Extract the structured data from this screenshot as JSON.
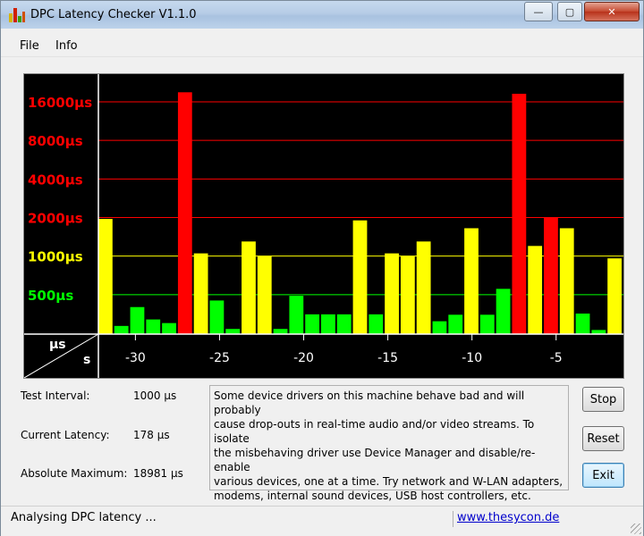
{
  "window": {
    "title": "DPC Latency Checker V1.1.0"
  },
  "title_controls": {
    "minimize": "—",
    "maximize": "▢",
    "close": "✕"
  },
  "menu": {
    "file": "File",
    "info": "Info"
  },
  "colors": {
    "red": "#ff0000",
    "yellow": "#ffff00",
    "green": "#00ff00"
  },
  "chart_data": {
    "type": "bar",
    "y_scale": "log",
    "y_ticks": [
      {
        "label": "16000µs",
        "value": 16000,
        "color": "#ff0000"
      },
      {
        "label": "8000µs",
        "value": 8000,
        "color": "#ff0000"
      },
      {
        "label": "4000µs",
        "value": 4000,
        "color": "#ff0000"
      },
      {
        "label": "2000µs",
        "value": 2000,
        "color": "#ff0000"
      },
      {
        "label": "1000µs",
        "value": 1000,
        "color": "#ffff00"
      },
      {
        "label": "500µs",
        "value": 500,
        "color": "#00ff00"
      }
    ],
    "axis_corner": {
      "y_unit": "µs",
      "x_unit": "s"
    },
    "x_ticks": [
      {
        "label": "-30",
        "value": -30
      },
      {
        "label": "-25",
        "value": -25
      },
      {
        "label": "-20",
        "value": -20
      },
      {
        "label": "-15",
        "value": -15
      },
      {
        "label": "-10",
        "value": -10
      },
      {
        "label": "-5",
        "value": -5
      }
    ],
    "x_range": [
      -32.2,
      -1.0
    ],
    "bar_width_s": 0.9,
    "values_us": [
      1950,
      285,
      400,
      175,
      300,
      19000,
      1050,
      450,
      270,
      1300,
      1000,
      270,
      490,
      240,
      240,
      240,
      1900,
      240,
      1050,
      1000,
      1300,
      310,
      235,
      1650,
      235,
      555,
      18500,
      1200,
      2000,
      1650,
      250,
      265,
      960
    ]
  },
  "info": {
    "test_interval_label": "Test Interval:",
    "test_interval_value": "1000 µs",
    "current_latency_label": "Current Latency:",
    "current_latency_value": "178 µs",
    "absolute_max_label": "Absolute Maximum:",
    "absolute_max_value": "18981 µs"
  },
  "message": [
    "Some device drivers on this machine behave bad and will probably",
    "cause drop-outs in real-time audio and/or video streams. To isolate",
    "the misbehaving driver use Device Manager and disable/re-enable",
    "various devices, one at a time. Try network and W-LAN adapters,",
    "modems, internal sound devices, USB host controllers, etc."
  ],
  "buttons": {
    "stop": "Stop",
    "reset": "Reset",
    "exit": "Exit"
  },
  "status": {
    "text": "Analysing DPC latency ...",
    "link": "www.thesycon.de"
  }
}
